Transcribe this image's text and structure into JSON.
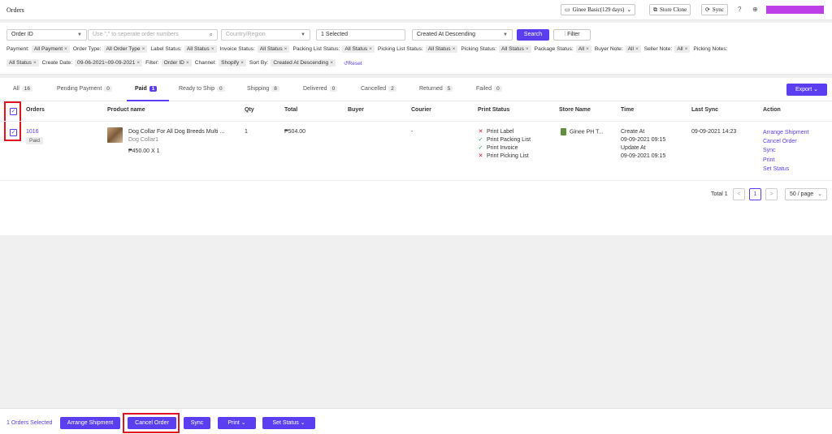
{
  "header": {
    "title": "Orders",
    "plan_label": "Ginee Basic(129 days)",
    "store_clone_label": "Store Clone",
    "sync_label": "Sync"
  },
  "filters": {
    "order_id_select": "Order ID",
    "search_placeholder": "Use \",\" to seperate order numbers",
    "country_placeholder": "Country/Region",
    "selected_value": "1 Selected",
    "sort_select": "Created At Descending",
    "search_button": "Search",
    "filter_button": "Filter",
    "row1": [
      {
        "label": "Payment:",
        "tag": "All Payment"
      },
      {
        "label": "Order Type:",
        "tag": "All Order Type"
      },
      {
        "label": "Label Status:",
        "tag": "All Status"
      },
      {
        "label": "Invoice Status:",
        "tag": "All Status"
      },
      {
        "label": "Packing List Status:",
        "tag": "All Status"
      },
      {
        "label": "Picking List Status:",
        "tag": "All Status"
      },
      {
        "label": "Picking Status:",
        "tag": "All Status"
      },
      {
        "label": "Package Status:",
        "tag": "All"
      },
      {
        "label": "Buyer Note:",
        "tag": "All"
      },
      {
        "label": "Seller Note:",
        "tag": "All"
      },
      {
        "label": "Picking Notes:",
        "tag": ""
      }
    ],
    "row2": [
      {
        "label": "",
        "tag": "All Status"
      },
      {
        "label": "Create Date:",
        "tag": "09-06-2021~09-09-2021"
      },
      {
        "label": "Filter:",
        "tag": "Order ID"
      },
      {
        "label": "Channel:",
        "tag": "Shopify"
      },
      {
        "label": "Sort By:",
        "tag": "Created At Descending"
      }
    ],
    "reset_label": "Reset"
  },
  "tabs": [
    {
      "label": "All",
      "count": "16"
    },
    {
      "label": "Pending Payment",
      "count": "0"
    },
    {
      "label": "Paid",
      "count": "1"
    },
    {
      "label": "Ready to Ship",
      "count": "0"
    },
    {
      "label": "Shipping",
      "count": "8"
    },
    {
      "label": "Delivered",
      "count": "0"
    },
    {
      "label": "Cancelled",
      "count": "2"
    },
    {
      "label": "Returned",
      "count": "5"
    },
    {
      "label": "Failed",
      "count": "0"
    }
  ],
  "export_label": "Export",
  "table": {
    "headers": [
      "Orders",
      "Product name",
      "Qty",
      "Total",
      "Buyer",
      "Courier",
      "Print Status",
      "Store Name",
      "Time",
      "Last Sync",
      "Action"
    ],
    "row": {
      "order_id": "1016",
      "status_badge": "Paid",
      "product_name": "Dog Collar For All Dog Breeds Multi ...",
      "variant": "Dog Collar1",
      "unit_price": "₱450.00 X 1",
      "qty": "1",
      "total": "₱504.00",
      "buyer": "",
      "courier": "-",
      "print_status": [
        {
          "label": "Print Label",
          "done": false
        },
        {
          "label": "Print Packing List",
          "done": true
        },
        {
          "label": "Print Invoice",
          "done": true
        },
        {
          "label": "Print Picking List",
          "done": false
        }
      ],
      "store_name": "Ginee PH T...",
      "time_create_label": "Create At",
      "time_create": "09-09-2021 09:15",
      "time_update_label": "Update At",
      "time_update": "09-09-2021 09:15",
      "last_sync": "09-09-2021 14:23",
      "actions": [
        "Arrange Shipment",
        "Cancel Order",
        "Sync",
        "Print",
        "Set Status"
      ]
    }
  },
  "pagination": {
    "total_label": "Total 1",
    "prev": "<",
    "current": "1",
    "next": ">",
    "page_size": "50 / page"
  },
  "bottom_bar": {
    "selected_text": "1 Orders Selected",
    "arrange_shipment": "Arrange Shipment",
    "cancel_order": "Cancel Order",
    "sync": "Sync",
    "print": "Print",
    "set_status": "Set Status"
  },
  "colors": {
    "accent": "#5b3ef0",
    "highlight": "#e0141e",
    "user_block": "#bc3fe8"
  }
}
